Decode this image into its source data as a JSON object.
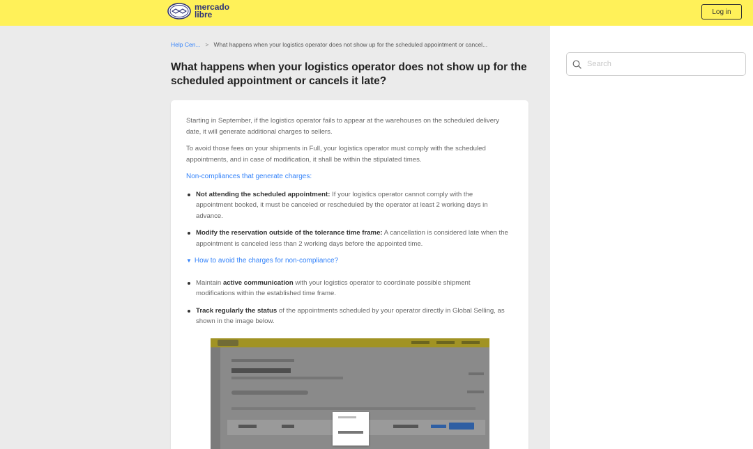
{
  "header": {
    "logo_line1": "mercado",
    "logo_line2": "libre",
    "login_label": "Log in",
    "bg_color": "#fff159"
  },
  "sidebar": {
    "search_placeholder": "Search"
  },
  "breadcrumb": {
    "items": [
      "Help Cen...",
      "What happens when your logistics operator does not show up for the scheduled appointment or cancel..."
    ],
    "separator": ">"
  },
  "article": {
    "title": "What happens when your logistics operator does not show up for the scheduled appointment or cancels it late?",
    "para1": "Starting in September, if the logistics operator fails to appear at the warehouses on the scheduled delivery date, it will generate additional charges to sellers.",
    "para2": "To avoid those fees on your shipments in Full, your logistics operator must comply with the scheduled appointments, and in case of modification, it shall be within the stipulated times.",
    "section_heading": "Non-compliances that generate charges:",
    "charges": [
      {
        "bold": "Not attending the scheduled appointment:",
        "text": " If your logistics operator cannot comply with the appointment booked, it must be canceled or rescheduled by the operator at least 2 working days in advance."
      },
      {
        "bold": "Modify the reservation outside of the tolerance time frame:",
        "text": " A cancellation is considered late when the appointment is canceled less than 2 working days before the appointed time."
      }
    ],
    "collapse_label": "How to avoid the charges for non-compliance?",
    "tips": [
      {
        "pre": "Maintain ",
        "bold": "active communication",
        "text": " with your logistics operator to coordinate possible shipment modifications within the established time frame."
      },
      {
        "pre": "",
        "bold": "Track regularly the status",
        "text": " of the appointments scheduled by your operator directly in Global Selling, as shown in the image below."
      }
    ],
    "link_color": "#3483fa"
  }
}
